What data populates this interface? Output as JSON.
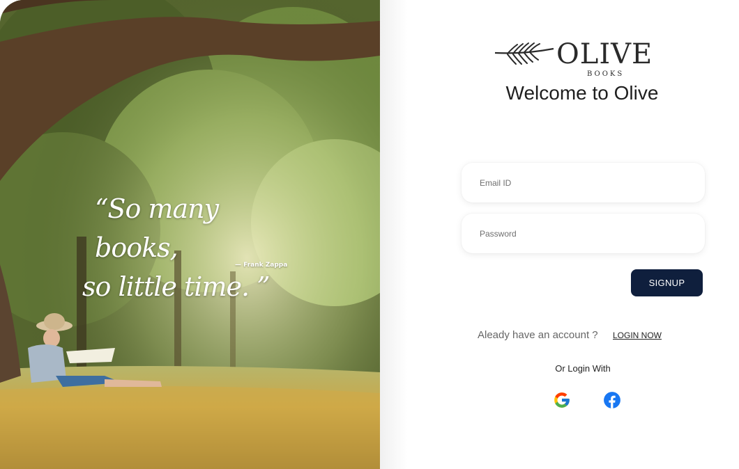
{
  "hero": {
    "quote_line1": "“So many books,",
    "quote_line2": "so little time. ”",
    "quote_author": "— Frank Zappa"
  },
  "brand": {
    "wordmark": "OLIVE",
    "subtitle": "BOOKS",
    "welcome": "Welcome to Olive"
  },
  "form": {
    "email_placeholder": "Email ID",
    "password_placeholder": "Password",
    "signup_label": "SIGNUP"
  },
  "account": {
    "prompt": "Aleady have an account ?",
    "login_link": "LOGIN NOW",
    "or_login_with": "Or Login With"
  },
  "social": {
    "google_icon": "google-icon",
    "facebook_icon": "facebook-icon"
  },
  "colors": {
    "button_bg": "#0f1f3d",
    "facebook_blue": "#1877f2"
  }
}
